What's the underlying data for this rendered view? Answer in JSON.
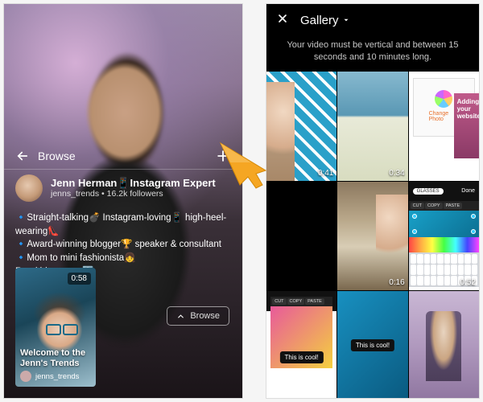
{
  "left": {
    "browse_label": "Browse",
    "channel": {
      "name": "Jenn Herman📱Instagram Expert",
      "handle": "jenns_trends",
      "followers": "16.2k followers"
    },
    "bio": {
      "l1": "🔹Straight-talking💣 Instagram-loving📱 high-heel-wearing👠",
      "l2": "🔹Award-winning blogger🏆 speaker & consultant",
      "l3": "🔹Mom to mini fashionista👧",
      "l4": "Read blog posts⬇️"
    },
    "video": {
      "duration": "0:58",
      "title": "Welcome to the Jenn's Trends",
      "user": "jenns_trends"
    },
    "browse_chip": "Browse"
  },
  "right": {
    "title": "Gallery",
    "hint": "Your video must be vertical and between 15 seconds and 10 minutes long.",
    "promo_text": "Adding your website",
    "change_photo": "Change Photo",
    "editor": {
      "glasses_pill": "GLASSES",
      "done": "Done",
      "menu_cut": "CUT",
      "menu_copy": "COPY",
      "menu_paste": "PASTE"
    },
    "cool_label": "This is cool!",
    "durations": {
      "c1": "0:41",
      "c2": "0:34",
      "c5": "0:16",
      "c6": "0:52"
    }
  }
}
